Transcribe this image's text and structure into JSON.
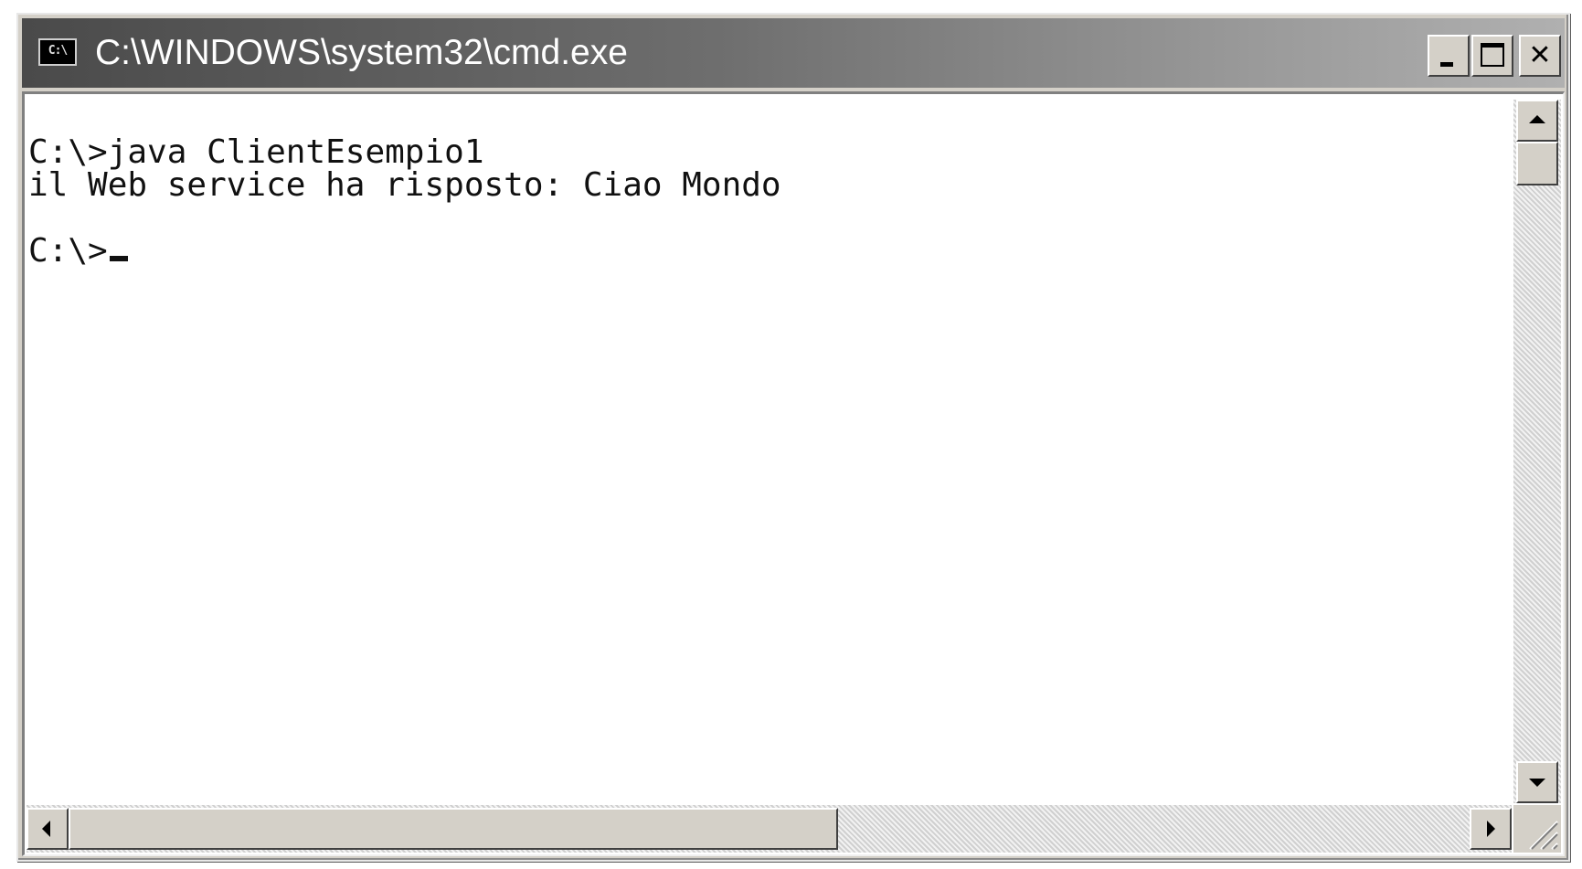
{
  "window": {
    "title": "C:\\WINDOWS\\system32\\cmd.exe",
    "icon_label": "C:\\",
    "icon": "console-icon",
    "buttons": {
      "minimize_icon": "minimize-icon",
      "maximize_icon": "maximize-icon",
      "close_icon": "close-icon",
      "close_glyph": "✕"
    }
  },
  "console": {
    "lines": [
      "",
      "C:\\>java ClientEsempio1",
      "il Web service ha risposto: Ciao Mondo",
      "",
      "C:\\>"
    ],
    "colors": {
      "background": "#ffffff",
      "text": "#111111",
      "titlebar_start": "#4a4a4a",
      "titlebar_end": "#b0b0b0"
    }
  },
  "scrollbars": {
    "vertical": {
      "up_icon": "arrow-up-icon",
      "down_icon": "arrow-down-icon",
      "position": 0
    },
    "horizontal": {
      "left_icon": "arrow-left-icon",
      "right_icon": "arrow-right-icon",
      "position": 0
    }
  }
}
